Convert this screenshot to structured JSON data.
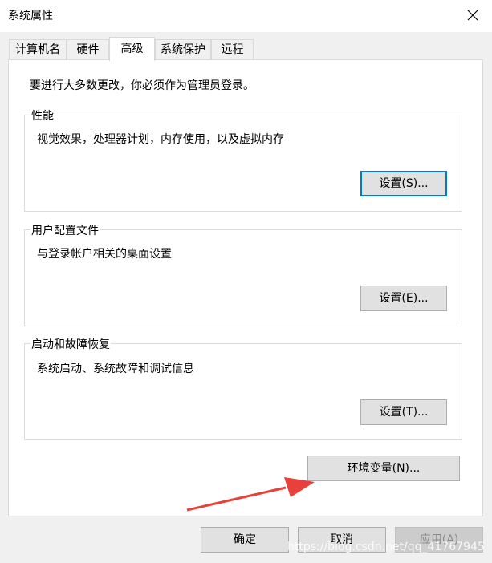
{
  "window": {
    "title": "系统属性",
    "close_icon": "close-icon"
  },
  "tabs": [
    {
      "label": "计算机名",
      "active": false
    },
    {
      "label": "硬件",
      "active": false
    },
    {
      "label": "高级",
      "active": true
    },
    {
      "label": "系统保护",
      "active": false
    },
    {
      "label": "远程",
      "active": false
    }
  ],
  "panel": {
    "intro": "要进行大多数更改，你必须作为管理员登录。",
    "performance": {
      "title": "性能",
      "desc": "视觉效果，处理器计划，内存使用，以及虚拟内存",
      "button": "设置(S)..."
    },
    "user_profiles": {
      "title": "用户配置文件",
      "desc": "与登录帐户相关的桌面设置",
      "button": "设置(E)..."
    },
    "startup_recovery": {
      "title": "启动和故障恢复",
      "desc": "系统启动、系统故障和调试信息",
      "button": "设置(T)..."
    },
    "env_button": "环境变量(N)..."
  },
  "footer": {
    "ok": "确定",
    "cancel": "取消",
    "apply": "应用(A)"
  },
  "watermark": "https://blog.csdn.net/qq_41767945",
  "colors": {
    "arrow": "#e8403a",
    "focus_border": "#0078d7"
  }
}
